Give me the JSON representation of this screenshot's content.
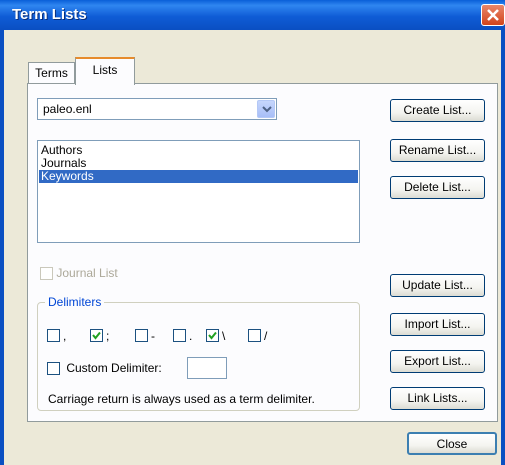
{
  "window": {
    "title": "Term Lists"
  },
  "tabs": [
    {
      "label": "Terms"
    },
    {
      "label": "Lists"
    }
  ],
  "library_select": {
    "value": "paleo.enl"
  },
  "lists": [
    {
      "label": "Authors",
      "selected": false
    },
    {
      "label": "Journals",
      "selected": false
    },
    {
      "label": "Keywords",
      "selected": true
    }
  ],
  "side_buttons": {
    "create": "Create List...",
    "rename": "Rename List...",
    "delete": "Delete List...",
    "update": "Update List...",
    "import": "Import List...",
    "export": "Export List...",
    "link": "Link Lists..."
  },
  "journal_list": {
    "label": "Journal List",
    "checked": false,
    "enabled": false
  },
  "delimiters": {
    "group_label": "Delimiters",
    "items": [
      {
        "symbol": ",",
        "checked": false
      },
      {
        "symbol": ";",
        "checked": true
      },
      {
        "symbol": "-",
        "checked": false
      },
      {
        "symbol": ".",
        "checked": false
      },
      {
        "symbol": "\\",
        "checked": true
      },
      {
        "symbol": "/",
        "checked": false
      }
    ],
    "custom_label": "Custom Delimiter:",
    "custom_checked": false,
    "custom_value": "",
    "note": "Carriage return is always used as a term delimiter."
  },
  "footer": {
    "close_label": "Close"
  },
  "colors": {
    "title_bar": "#0a5fd8",
    "selection": "#316ac5",
    "tab_accent": "#e68b2c",
    "close_red": "#d2441c"
  }
}
